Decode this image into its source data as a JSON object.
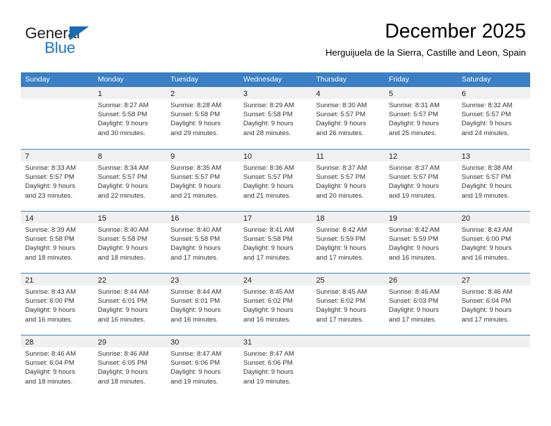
{
  "brand": {
    "name_part1": "General",
    "name_part2": "Blue",
    "triangle_color": "#1a6bb5",
    "blue_color": "#1877c9"
  },
  "header": {
    "month_title": "December 2025",
    "location": "Herguijuela de la Sierra, Castille and Leon, Spain",
    "header_bg": "#3b7fc4",
    "day_band_bg": "#f0f0f0"
  },
  "weekdays": [
    "Sunday",
    "Monday",
    "Tuesday",
    "Wednesday",
    "Thursday",
    "Friday",
    "Saturday"
  ],
  "weeks": [
    {
      "days": [
        {
          "num": "",
          "empty": true,
          "sunrise": "",
          "sunset": "",
          "daylight_line1": "",
          "daylight_line2": ""
        },
        {
          "num": "1",
          "empty": false,
          "sunrise": "Sunrise: 8:27 AM",
          "sunset": "Sunset: 5:58 PM",
          "daylight_line1": "Daylight: 9 hours",
          "daylight_line2": "and 30 minutes."
        },
        {
          "num": "2",
          "empty": false,
          "sunrise": "Sunrise: 8:28 AM",
          "sunset": "Sunset: 5:58 PM",
          "daylight_line1": "Daylight: 9 hours",
          "daylight_line2": "and 29 minutes."
        },
        {
          "num": "3",
          "empty": false,
          "sunrise": "Sunrise: 8:29 AM",
          "sunset": "Sunset: 5:58 PM",
          "daylight_line1": "Daylight: 9 hours",
          "daylight_line2": "and 28 minutes."
        },
        {
          "num": "4",
          "empty": false,
          "sunrise": "Sunrise: 8:30 AM",
          "sunset": "Sunset: 5:57 PM",
          "daylight_line1": "Daylight: 9 hours",
          "daylight_line2": "and 26 minutes."
        },
        {
          "num": "5",
          "empty": false,
          "sunrise": "Sunrise: 8:31 AM",
          "sunset": "Sunset: 5:57 PM",
          "daylight_line1": "Daylight: 9 hours",
          "daylight_line2": "and 25 minutes."
        },
        {
          "num": "6",
          "empty": false,
          "sunrise": "Sunrise: 8:32 AM",
          "sunset": "Sunset: 5:57 PM",
          "daylight_line1": "Daylight: 9 hours",
          "daylight_line2": "and 24 minutes."
        }
      ]
    },
    {
      "days": [
        {
          "num": "7",
          "empty": false,
          "sunrise": "Sunrise: 8:33 AM",
          "sunset": "Sunset: 5:57 PM",
          "daylight_line1": "Daylight: 9 hours",
          "daylight_line2": "and 23 minutes."
        },
        {
          "num": "8",
          "empty": false,
          "sunrise": "Sunrise: 8:34 AM",
          "sunset": "Sunset: 5:57 PM",
          "daylight_line1": "Daylight: 9 hours",
          "daylight_line2": "and 22 minutes."
        },
        {
          "num": "9",
          "empty": false,
          "sunrise": "Sunrise: 8:35 AM",
          "sunset": "Sunset: 5:57 PM",
          "daylight_line1": "Daylight: 9 hours",
          "daylight_line2": "and 21 minutes."
        },
        {
          "num": "10",
          "empty": false,
          "sunrise": "Sunrise: 8:36 AM",
          "sunset": "Sunset: 5:57 PM",
          "daylight_line1": "Daylight: 9 hours",
          "daylight_line2": "and 21 minutes."
        },
        {
          "num": "11",
          "empty": false,
          "sunrise": "Sunrise: 8:37 AM",
          "sunset": "Sunset: 5:57 PM",
          "daylight_line1": "Daylight: 9 hours",
          "daylight_line2": "and 20 minutes."
        },
        {
          "num": "12",
          "empty": false,
          "sunrise": "Sunrise: 8:37 AM",
          "sunset": "Sunset: 5:57 PM",
          "daylight_line1": "Daylight: 9 hours",
          "daylight_line2": "and 19 minutes."
        },
        {
          "num": "13",
          "empty": false,
          "sunrise": "Sunrise: 8:38 AM",
          "sunset": "Sunset: 5:57 PM",
          "daylight_line1": "Daylight: 9 hours",
          "daylight_line2": "and 19 minutes."
        }
      ]
    },
    {
      "days": [
        {
          "num": "14",
          "empty": false,
          "sunrise": "Sunrise: 8:39 AM",
          "sunset": "Sunset: 5:58 PM",
          "daylight_line1": "Daylight: 9 hours",
          "daylight_line2": "and 18 minutes."
        },
        {
          "num": "15",
          "empty": false,
          "sunrise": "Sunrise: 8:40 AM",
          "sunset": "Sunset: 5:58 PM",
          "daylight_line1": "Daylight: 9 hours",
          "daylight_line2": "and 18 minutes."
        },
        {
          "num": "16",
          "empty": false,
          "sunrise": "Sunrise: 8:40 AM",
          "sunset": "Sunset: 5:58 PM",
          "daylight_line1": "Daylight: 9 hours",
          "daylight_line2": "and 17 minutes."
        },
        {
          "num": "17",
          "empty": false,
          "sunrise": "Sunrise: 8:41 AM",
          "sunset": "Sunset: 5:58 PM",
          "daylight_line1": "Daylight: 9 hours",
          "daylight_line2": "and 17 minutes."
        },
        {
          "num": "18",
          "empty": false,
          "sunrise": "Sunrise: 8:42 AM",
          "sunset": "Sunset: 5:59 PM",
          "daylight_line1": "Daylight: 9 hours",
          "daylight_line2": "and 17 minutes."
        },
        {
          "num": "19",
          "empty": false,
          "sunrise": "Sunrise: 8:42 AM",
          "sunset": "Sunset: 5:59 PM",
          "daylight_line1": "Daylight: 9 hours",
          "daylight_line2": "and 16 minutes."
        },
        {
          "num": "20",
          "empty": false,
          "sunrise": "Sunrise: 8:43 AM",
          "sunset": "Sunset: 6:00 PM",
          "daylight_line1": "Daylight: 9 hours",
          "daylight_line2": "and 16 minutes."
        }
      ]
    },
    {
      "days": [
        {
          "num": "21",
          "empty": false,
          "sunrise": "Sunrise: 8:43 AM",
          "sunset": "Sunset: 6:00 PM",
          "daylight_line1": "Daylight: 9 hours",
          "daylight_line2": "and 16 minutes."
        },
        {
          "num": "22",
          "empty": false,
          "sunrise": "Sunrise: 8:44 AM",
          "sunset": "Sunset: 6:01 PM",
          "daylight_line1": "Daylight: 9 hours",
          "daylight_line2": "and 16 minutes."
        },
        {
          "num": "23",
          "empty": false,
          "sunrise": "Sunrise: 8:44 AM",
          "sunset": "Sunset: 6:01 PM",
          "daylight_line1": "Daylight: 9 hours",
          "daylight_line2": "and 16 minutes."
        },
        {
          "num": "24",
          "empty": false,
          "sunrise": "Sunrise: 8:45 AM",
          "sunset": "Sunset: 6:02 PM",
          "daylight_line1": "Daylight: 9 hours",
          "daylight_line2": "and 16 minutes."
        },
        {
          "num": "25",
          "empty": false,
          "sunrise": "Sunrise: 8:45 AM",
          "sunset": "Sunset: 6:02 PM",
          "daylight_line1": "Daylight: 9 hours",
          "daylight_line2": "and 17 minutes."
        },
        {
          "num": "26",
          "empty": false,
          "sunrise": "Sunrise: 8:46 AM",
          "sunset": "Sunset: 6:03 PM",
          "daylight_line1": "Daylight: 9 hours",
          "daylight_line2": "and 17 minutes."
        },
        {
          "num": "27",
          "empty": false,
          "sunrise": "Sunrise: 8:46 AM",
          "sunset": "Sunset: 6:04 PM",
          "daylight_line1": "Daylight: 9 hours",
          "daylight_line2": "and 17 minutes."
        }
      ]
    },
    {
      "days": [
        {
          "num": "28",
          "empty": false,
          "sunrise": "Sunrise: 8:46 AM",
          "sunset": "Sunset: 6:04 PM",
          "daylight_line1": "Daylight: 9 hours",
          "daylight_line2": "and 18 minutes."
        },
        {
          "num": "29",
          "empty": false,
          "sunrise": "Sunrise: 8:46 AM",
          "sunset": "Sunset: 6:05 PM",
          "daylight_line1": "Daylight: 9 hours",
          "daylight_line2": "and 18 minutes."
        },
        {
          "num": "30",
          "empty": false,
          "sunrise": "Sunrise: 8:47 AM",
          "sunset": "Sunset: 6:06 PM",
          "daylight_line1": "Daylight: 9 hours",
          "daylight_line2": "and 19 minutes."
        },
        {
          "num": "31",
          "empty": false,
          "sunrise": "Sunrise: 8:47 AM",
          "sunset": "Sunset: 6:06 PM",
          "daylight_line1": "Daylight: 9 hours",
          "daylight_line2": "and 19 minutes."
        },
        {
          "num": "",
          "empty": true,
          "sunrise": "",
          "sunset": "",
          "daylight_line1": "",
          "daylight_line2": ""
        },
        {
          "num": "",
          "empty": true,
          "sunrise": "",
          "sunset": "",
          "daylight_line1": "",
          "daylight_line2": ""
        },
        {
          "num": "",
          "empty": true,
          "sunrise": "",
          "sunset": "",
          "daylight_line1": "",
          "daylight_line2": ""
        }
      ]
    }
  ]
}
